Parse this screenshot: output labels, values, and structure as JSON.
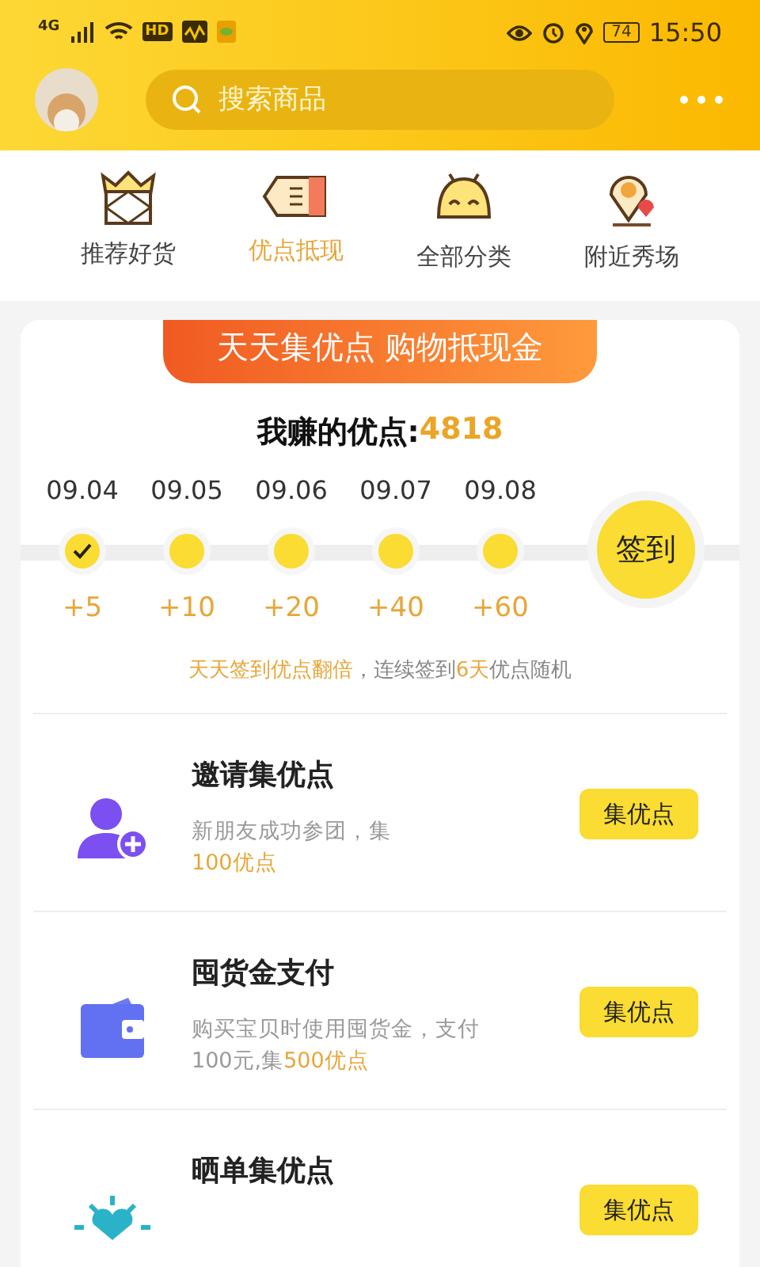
{
  "status_bar": {
    "network": "4G",
    "hd": "HD",
    "battery": "74",
    "time": "15:50"
  },
  "search": {
    "placeholder": "搜索商品"
  },
  "nav": [
    {
      "label": "推荐好货",
      "selected": false,
      "kind": "crown"
    },
    {
      "label": "优点抵现",
      "selected": true,
      "kind": "coupon"
    },
    {
      "label": "全部分类",
      "selected": false,
      "kind": "bag"
    },
    {
      "label": "附近秀场",
      "selected": false,
      "kind": "pin"
    }
  ],
  "banner": "天天集优点 购物抵现金",
  "points": {
    "label": "我赚的优点:",
    "value": "4818"
  },
  "days": [
    {
      "date": "09.04",
      "points": "+5",
      "checked": true
    },
    {
      "date": "09.05",
      "points": "+10",
      "checked": false
    },
    {
      "date": "09.06",
      "points": "+20",
      "checked": false
    },
    {
      "date": "09.07",
      "points": "+40",
      "checked": false
    },
    {
      "date": "09.08",
      "points": "+60",
      "checked": false
    }
  ],
  "sign_button": "签到",
  "tip": "**天天签到优点翻倍**，连续签到**6天**优点随机",
  "tasks": [
    {
      "kind": "invite",
      "title": "邀请集优点",
      "lines": [
        "新朋友成功参团，集",
        "**100优点**"
      ],
      "button": "集优点"
    },
    {
      "kind": "wallet",
      "title": "囤货金支付",
      "lines": [
        "购买宝贝时使用囤货金，支付",
        "100元,集**500优点**"
      ],
      "button": "集优点"
    },
    {
      "kind": "share",
      "title": "晒单集优点",
      "button": "集优点"
    }
  ]
}
